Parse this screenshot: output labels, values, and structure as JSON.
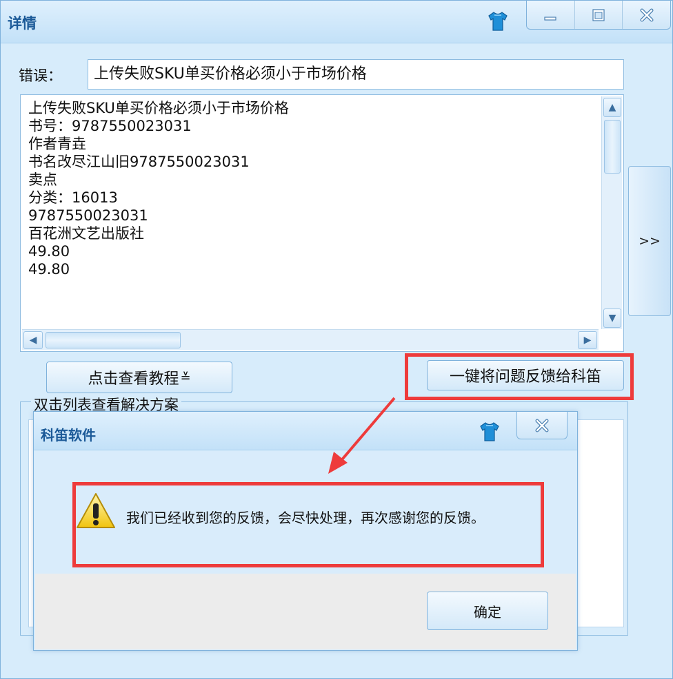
{
  "main_window": {
    "title": "详情",
    "error_label": "错误：",
    "error_value": "上传失败SKU单买价格必须小于市场价格",
    "detail_lines": [
      "上传失败SKU单买价格必须小于市场价格",
      "书号：9787550023031",
      "作者青垚",
      "书名改尽江山旧9787550023031",
      "卖点",
      "分类：16013",
      "9787550023031",
      "百花洲文艺出版社",
      "49.80",
      "49.80"
    ],
    "expand_label": ">>",
    "tutorial_button": "点击查看教程",
    "tutorial_chevron": "≚",
    "feedback_button": "一键将问题反馈给科笛",
    "group_label": "双击列表查看解决方案"
  },
  "dialog": {
    "title": "科笛软件",
    "message": "我们已经收到您的反馈，会尽快处理，再次感谢您的反馈。",
    "ok_button": "确定"
  },
  "icons": {
    "app": "shirt-icon",
    "warning": "warning-icon",
    "minimize": "minimize-icon",
    "maximize": "maximize-icon",
    "close": "close-icon"
  },
  "colors": {
    "window_bg": "#d7ecfb",
    "title_text": "#1c5a98",
    "highlight": "#ee3b3b"
  }
}
